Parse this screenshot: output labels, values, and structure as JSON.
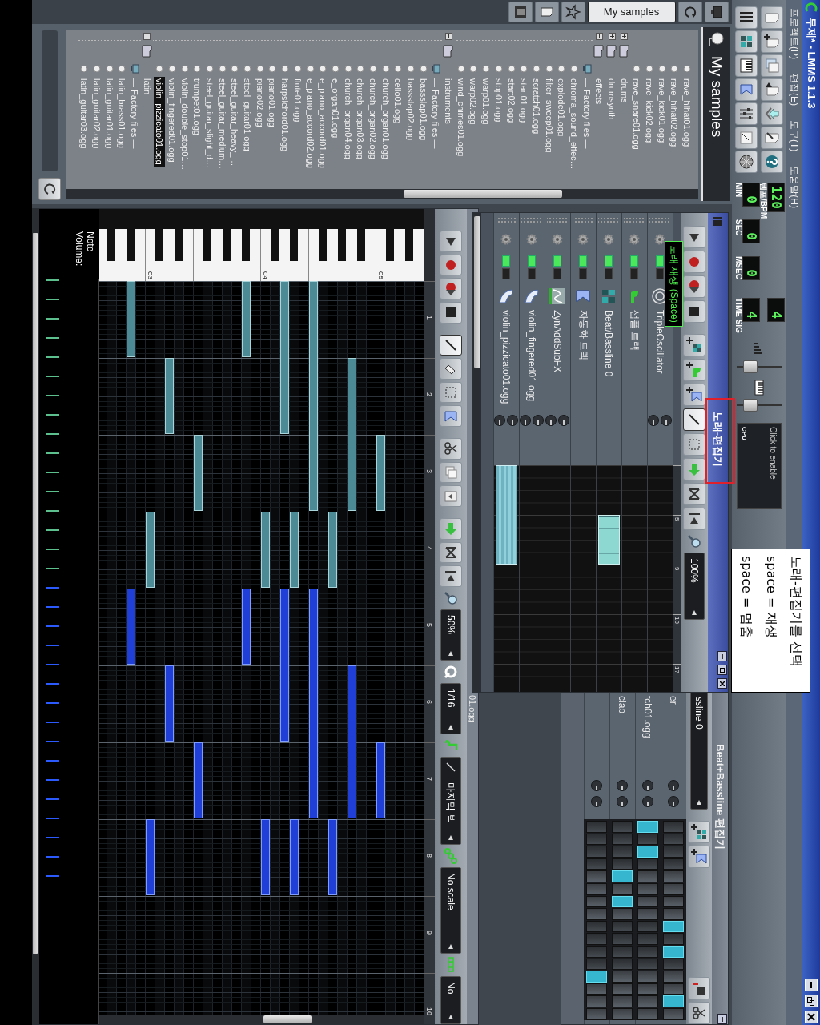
{
  "window": {
    "title": "무제* - LMMS 1.1.3"
  },
  "menu": [
    "프로젝트(P)",
    "편집(E)",
    "도구(T)",
    "도움말(H)"
  ],
  "toolbar": {
    "tempo": {
      "value": "120",
      "label": "템포/BPM"
    },
    "time": [
      {
        "value": "0",
        "label": "MIN"
      },
      {
        "value": "0",
        "label": "SEC"
      },
      {
        "value": "0",
        "label": "MSEC"
      }
    ],
    "time_sig": {
      "numerator": "4",
      "denominator": "4",
      "label": "TIME SIG"
    },
    "master_volume": {
      "level": 0.2
    },
    "master_pitch": {
      "level": 0.2
    },
    "cpu": {
      "label": "CPU",
      "text": "Click to enable"
    }
  },
  "sidebar": {
    "tabs": [
      {
        "selected": false
      },
      {
        "selected": false
      },
      {
        "label": "My samples",
        "selected": true
      },
      {
        "selected": false
      },
      {
        "selected": false
      },
      {
        "selected": false
      }
    ]
  },
  "file_browser": {
    "title": "My samples",
    "items": [
      {
        "kind": "file",
        "name": "rave_hihat01.ogg",
        "selected": false
      },
      {
        "kind": "file",
        "name": "rave_hihat02.ogg",
        "selected": false
      },
      {
        "kind": "file",
        "name": "rave_kick01.ogg",
        "selected": false
      },
      {
        "kind": "file",
        "name": "rave_kick02.ogg",
        "selected": false
      },
      {
        "kind": "file",
        "name": "rave_snare01.ogg",
        "selected": false
      },
      {
        "kind": "folder",
        "name": "drums",
        "expanded": false,
        "selected": false
      },
      {
        "kind": "folder",
        "name": "drumsynth",
        "expanded": false,
        "selected": false
      },
      {
        "kind": "folder",
        "name": "effects",
        "expanded": true,
        "selected": false,
        "children": [
          {
            "kind": "group",
            "name": "— Factory files —",
            "selected": false
          },
          {
            "kind": "file",
            "name": "chroma_sound_effec…",
            "selected": false
          },
          {
            "kind": "file",
            "name": "explode01.ogg",
            "selected": false
          },
          {
            "kind": "file",
            "name": "filter_sweep01.ogg",
            "selected": false
          },
          {
            "kind": "file",
            "name": "scratch01.ogg",
            "selected": false
          },
          {
            "kind": "file",
            "name": "start01.ogg",
            "selected": false
          },
          {
            "kind": "file",
            "name": "start02.ogg",
            "selected": false
          },
          {
            "kind": "file",
            "name": "stop01.ogg",
            "selected": false
          },
          {
            "kind": "file",
            "name": "warp01.ogg",
            "selected": false
          },
          {
            "kind": "file",
            "name": "warp02.ogg",
            "selected": false
          },
          {
            "kind": "file",
            "name": "wind_chimes01.ogg",
            "selected": false
          }
        ]
      },
      {
        "kind": "folder",
        "name": "instruments",
        "expanded": true,
        "selected": false,
        "children": [
          {
            "kind": "group",
            "name": "— Factory files —",
            "selected": false
          },
          {
            "kind": "file",
            "name": "bassslap01.ogg",
            "selected": false
          },
          {
            "kind": "file",
            "name": "bassslap02.ogg",
            "selected": false
          },
          {
            "kind": "file",
            "name": "cello01.ogg",
            "selected": false
          },
          {
            "kind": "file",
            "name": "church_organ01.ogg",
            "selected": false
          },
          {
            "kind": "file",
            "name": "church_organ02.ogg",
            "selected": false
          },
          {
            "kind": "file",
            "name": "church_organ03.ogg",
            "selected": false
          },
          {
            "kind": "file",
            "name": "church_organ04.ogg",
            "selected": false
          },
          {
            "kind": "file",
            "name": "e_organ01.ogg",
            "selected": false
          },
          {
            "kind": "file",
            "name": "e_piano_accord01.ogg",
            "selected": false
          },
          {
            "kind": "file",
            "name": "e_piano_accord02.ogg",
            "selected": false
          },
          {
            "kind": "file",
            "name": "flute01.ogg",
            "selected": false
          },
          {
            "kind": "file",
            "name": "harpsichord01.ogg",
            "selected": false
          },
          {
            "kind": "file",
            "name": "piano01.ogg",
            "selected": false
          },
          {
            "kind": "file",
            "name": "piano02.ogg",
            "selected": false
          },
          {
            "kind": "file",
            "name": "steel_guitar01.ogg",
            "selected": false
          },
          {
            "kind": "file",
            "name": "steel_guitar_heavy_…",
            "selected": false
          },
          {
            "kind": "file",
            "name": "steel_guitar_medium…",
            "selected": false
          },
          {
            "kind": "file",
            "name": "steel_guitar_slight_d…",
            "selected": false
          },
          {
            "kind": "file",
            "name": "trumpet01.ogg",
            "selected": false
          },
          {
            "kind": "file",
            "name": "violin_double_stop01…",
            "selected": false
          },
          {
            "kind": "file",
            "name": "violin_fingered01.ogg",
            "selected": false
          },
          {
            "kind": "file",
            "name": "violin_pizzicato01.ogg",
            "selected": true
          }
        ]
      },
      {
        "kind": "folder",
        "name": "latin",
        "expanded": true,
        "selected": false,
        "children": [
          {
            "kind": "group",
            "name": "— Factory files —",
            "selected": false
          },
          {
            "kind": "file",
            "name": "latin_brass01.ogg",
            "selected": false
          },
          {
            "kind": "file",
            "name": "latin_guitar01.ogg",
            "selected": false
          },
          {
            "kind": "file",
            "name": "latin_guitar02.ogg",
            "selected": false
          },
          {
            "kind": "file",
            "name": "latin_guitar03.ogg",
            "selected": false
          }
        ]
      }
    ]
  },
  "song_editor": {
    "title": "노래-편집기",
    "tools": [
      {
        "selected": true
      },
      {
        "selected": false
      }
    ],
    "zoom": "100%",
    "tooltip": "노래 재생 (Space)",
    "ruler": [
      "5",
      "9",
      "13",
      "17"
    ],
    "tracks": [
      {
        "kind": "oscillator",
        "name": "TripleOscillator",
        "muted": false
      },
      {
        "kind": "sample",
        "name": "샘플 트랙",
        "muted": false
      },
      {
        "kind": "beat",
        "name": "Beat/Bassline 0",
        "muted": false
      },
      {
        "kind": "automation",
        "name": "자동화 트랙",
        "muted": false
      },
      {
        "kind": "synth",
        "name": "ZynAddSubFX",
        "muted": false
      },
      {
        "kind": "audiofile",
        "name": "violin_fingered01.ogg",
        "muted": false
      },
      {
        "kind": "audiofile",
        "name": "violin_pizzicato01.ogg",
        "muted": false
      }
    ]
  },
  "bb_editor": {
    "title": "Beat+Bassline 편집기",
    "selector": "ssline 0",
    "tracks": [
      {
        "name": "er",
        "steps": [
          false,
          false,
          false,
          false,
          false,
          false,
          false,
          false,
          true,
          false,
          true,
          false,
          false,
          false,
          true,
          false
        ]
      },
      {
        "name": "tch01.ogg",
        "steps": [
          true,
          false,
          true,
          false,
          false,
          false,
          false,
          false,
          false,
          false,
          false,
          false,
          false,
          false,
          false,
          false
        ]
      },
      {
        "name": "clap",
        "steps": [
          false,
          false,
          false,
          false,
          true,
          false,
          true,
          false,
          false,
          false,
          false,
          false,
          false,
          false,
          false,
          false
        ]
      },
      {
        "steps": [
          false,
          false,
          false,
          false,
          false,
          false,
          false,
          false,
          false,
          false,
          false,
          false,
          true,
          false,
          false,
          false
        ]
      }
    ]
  },
  "piano_roll": {
    "title": "01.ogg",
    "tools": [
      {
        "selected": true
      },
      {
        "selected": false
      },
      {
        "selected": false
      },
      {
        "selected": false
      }
    ],
    "zoom": "50%",
    "quantize": "1/16",
    "note_length": "마지막 박",
    "scale": "No scale",
    "chord": "No",
    "bars": [
      "1",
      "2",
      "3",
      "4",
      "5",
      "6",
      "7",
      "8",
      "9",
      "10"
    ],
    "keys": [
      "C5",
      "C4",
      "C3"
    ],
    "volume_label": "Note Volume:"
  },
  "annotation": {
    "lines": [
      "노래-편집기를 선택",
      "space = 재생",
      "space = 멈춤"
    ]
  }
}
